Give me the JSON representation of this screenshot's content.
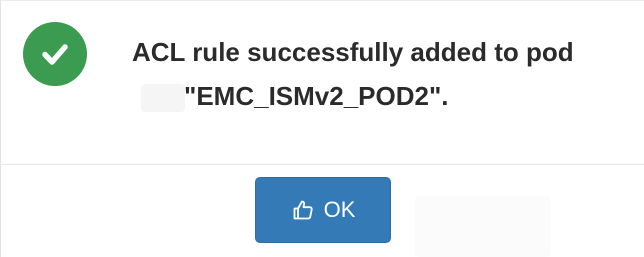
{
  "dialog": {
    "icon": "check-circle-icon",
    "message_line1": "ACL rule successfully added to pod",
    "message_line2": "\"EMC_ISMv2_POD2\".",
    "ok_icon": "thumbs-up-icon",
    "ok_label": "OK",
    "colors": {
      "success": "#3b9b50",
      "primary": "#337ab7",
      "text": "#2b2b2b"
    }
  }
}
